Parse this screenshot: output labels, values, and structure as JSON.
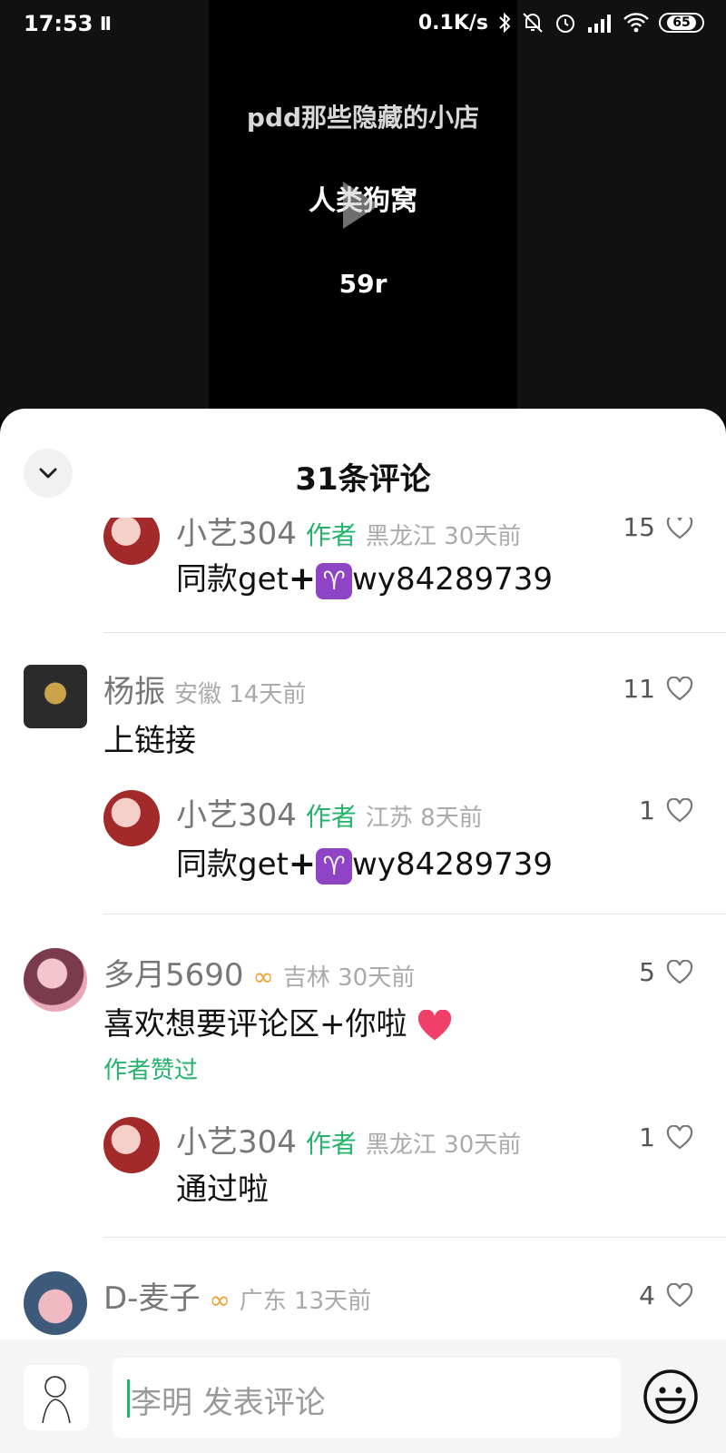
{
  "status_bar": {
    "time": "17:53",
    "pause_glyph": "II",
    "network_speed": "0.1K/s",
    "battery": "65"
  },
  "video": {
    "line1": "pdd那些隐藏的小店",
    "line2": "人类狗窝",
    "line3": "59r"
  },
  "comments_sheet": {
    "title": "31条评论",
    "comments": [
      {
        "username": "小艺304",
        "author_tag": "作者",
        "region_time": "黑龙江 30天前",
        "text_prefix": "同款get",
        "text_suffix": "wy84289739",
        "likes": "15"
      },
      {
        "username": "杨振",
        "region_time": "安徽 14天前",
        "text": "上链接",
        "likes": "11"
      },
      {
        "username": "小艺304",
        "author_tag": "作者",
        "region_time": "江苏 8天前",
        "text_prefix": "同款get",
        "text_suffix": "wy84289739",
        "likes": "1"
      },
      {
        "username": "多月5690",
        "region_time": "吉林 30天前",
        "text": "喜欢想要评论区+你啦",
        "liked_label": "作者赞过",
        "likes": "5"
      },
      {
        "username": "小艺304",
        "author_tag": "作者",
        "region_time": "黑龙江 30天前",
        "text": "通过啦",
        "likes": "1"
      },
      {
        "username": "D-麦子",
        "region_time": "广东 13天前",
        "likes": "4"
      }
    ]
  },
  "composer": {
    "placeholder": "李明 发表评论"
  },
  "colors": {
    "author_green": "#23b36b",
    "vip_gold": "#f0a030"
  },
  "icons": [
    "chevron-down-icon",
    "heart-icon",
    "play-icon",
    "emoji-icon",
    "bluetooth-icon",
    "wifi-icon",
    "battery-icon"
  ]
}
